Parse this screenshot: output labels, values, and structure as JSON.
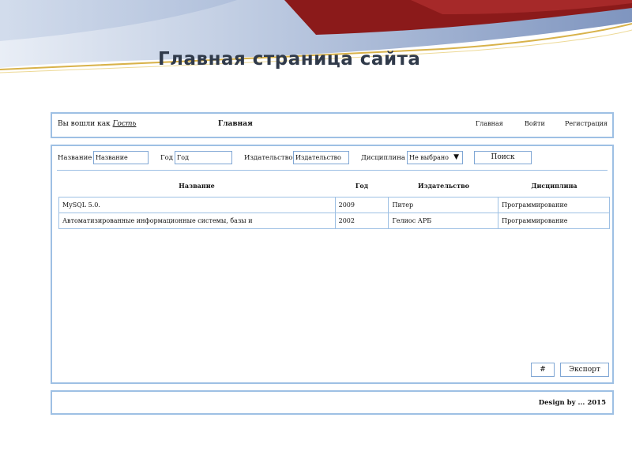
{
  "slide": {
    "title": "Главная страница сайта"
  },
  "header": {
    "login_prefix": "Вы вошли как",
    "user": "Гость",
    "page_name": "Главная",
    "nav": [
      "Главная",
      "Войти",
      "Регистрация"
    ]
  },
  "search": {
    "title_label": "Название",
    "title_value": "Название",
    "year_label": "Год",
    "year_value": "Год",
    "publisher_label": "Издательство",
    "publisher_value": "Издательство",
    "discipline_label": "Дисциплина",
    "discipline_value": "Не выбрано",
    "search_button": "Поиск"
  },
  "table": {
    "headers": [
      "Название",
      "Год",
      "Издательство",
      "Дисциплина"
    ],
    "rows": [
      [
        "MySQL 5.0.",
        "2009",
        "Питер",
        "Программирование"
      ],
      [
        "Автоматизированные информационные системы, базы и",
        "2002",
        "Гелиос АРБ",
        "Программирование"
      ]
    ]
  },
  "actions": {
    "hash_button": "#",
    "export_button": "Экспорт"
  },
  "footer": {
    "credit": "Design by ... 2015"
  },
  "colors": {
    "panel_border": "#9ec0e4",
    "deco_red": "#8b1a1a",
    "deco_blue": "#8fa4c8"
  }
}
